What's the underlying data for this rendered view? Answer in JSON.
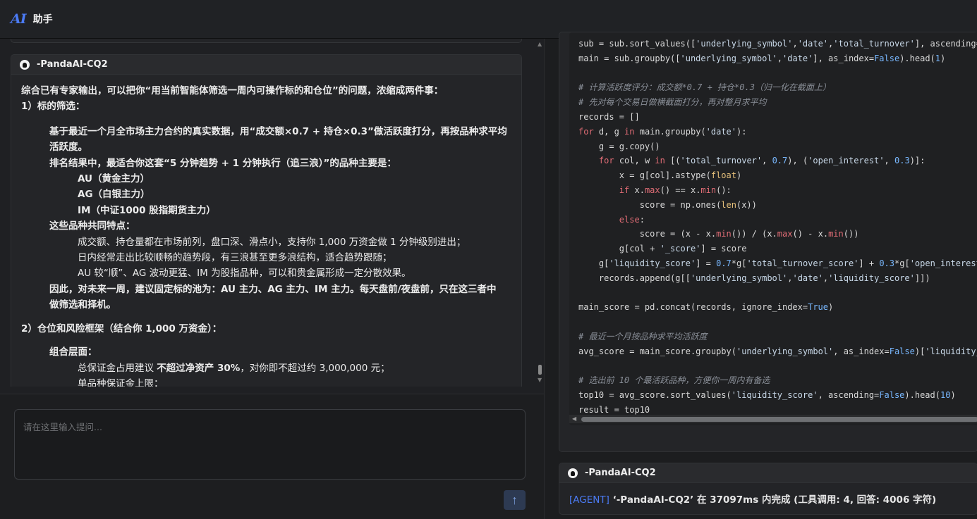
{
  "header": {
    "logo": "AI",
    "title": "助手"
  },
  "message": {
    "agent": "-PandaAI-CQ2",
    "lines": [
      "综合已有专家输出，可以把你“用当前智能体筛选一周内可操作标的和仓位”的问题，浓缩成两件事：",
      "1）标的筛选：",
      "基于最近一个月全市场主力合约的真实数据，用“成交额×0.7 + 持仓×0.3”做活跃度打分，再按品种求平均",
      "活跃度。",
      "排名结果中，最适合你这套“5 分钟趋势 + 1 分钟执行（追三浪）”的品种主要是：",
      "AU（黄金主力）",
      "AG（白银主力）",
      "IM（中证1000 股指期货主力）",
      "这些品种共同特点：",
      "成交额、持仓量都在市场前列，盘口深、滑点小，支持你 1,000 万资金做 1 分钟级别进出；",
      "日内经常走出比较顺畅的趋势段，有三浪甚至更多浪结构，适合趋势跟随；",
      "AU 较“顺”、AG 波动更猛、IM 为股指品种，可以和贵金属形成一定分散效果。",
      "因此，对未来一周，",
      "建议固定标的池为：AU 主力、AG 主力、IM 主力。",
      "每天盘前/夜盘前，只在这三者中",
      "做筛选和择机。",
      "2）仓位和风险框架（结合你 1,000 万资金）：",
      "组合层面：",
      "总保证金占用建议 ",
      "不超过净资产 30%",
      "，对你即不超过约 3,000,000 元；",
      "单品种保证金上限："
    ]
  },
  "input": {
    "placeholder": "请在这里输入提问..."
  },
  "code_lines": [
    "sub = sub.sort_values(['underlying_symbol','date','total_turnover'], ascending=[True",
    "main = sub.groupby(['underlying_symbol','date'], as_index=False).head(1)",
    "",
    "# 计算活跃度评分：成交额*0.7 + 持仓*0.3（归一化在截面上）",
    "# 先对每个交易日做横截面打分，再对整月求平均",
    "records = []",
    "for d, g in main.groupby('date'):",
    "    g = g.copy()",
    "    for col, w in [('total_turnover', 0.7), ('open_interest', 0.3)]:",
    "        x = g[col].astype(float)",
    "        if x.max() == x.min():",
    "            score = np.ones(len(x))",
    "        else:",
    "            score = (x - x.min()) / (x.max() - x.min())",
    "        g[col + '_score'] = score",
    "    g['liquidity_score'] = 0.7*g['total_turnover_score'] + 0.3*g['open_interest_scor",
    "    records.append(g[['underlying_symbol','date','liquidity_score']])",
    "",
    "main_score = pd.concat(records, ignore_index=True)",
    "",
    "# 最近一个月按品种求平均活跃度",
    "avg_score = main_score.groupby('underlying_symbol', as_index=False)['liquidity_scor",
    "",
    "# 选出前 10 个最活跃品种，方便你一周内有备选",
    "top10 = avg_score.sort_values('liquidity_score', ascending=False).head(10)",
    "result = top10"
  ],
  "status": {
    "agent": "-PandaAI-CQ2",
    "tag": "[AGENT]",
    "text": "‘-PandaAI-CQ2’ 在 37097ms 内完成 (工具调用: 4, 回答: 4006 字符)"
  },
  "colors": {
    "accent": "#4b7bf5",
    "background": "#1b1c1e"
  }
}
